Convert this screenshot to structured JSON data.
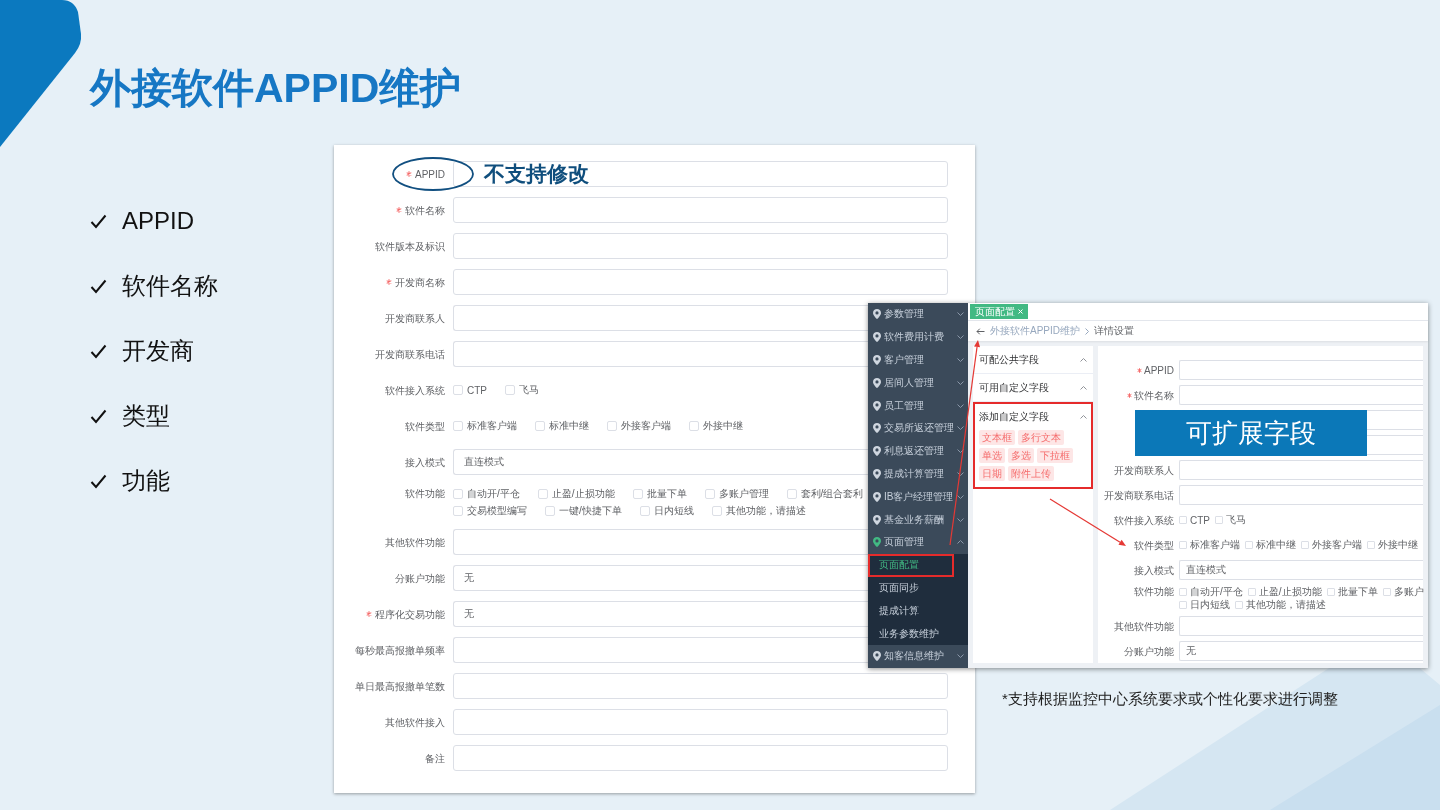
{
  "slide": {
    "title": "外接软件APPID维护"
  },
  "bullets": [
    "APPID",
    "软件名称",
    "开发商",
    "类型",
    "功能"
  ],
  "main_form": {
    "fields": [
      {
        "label": "APPID",
        "required": true,
        "kind": "input",
        "circled": true,
        "annotation": "不支持修改"
      },
      {
        "label": "软件名称",
        "required": true,
        "kind": "input",
        "circled": false
      },
      {
        "label": "软件版本及标识",
        "required": false,
        "kind": "input",
        "circled": false
      },
      {
        "label": "开发商名称",
        "required": true,
        "kind": "input",
        "circled": false
      },
      {
        "label": "开发商联系人",
        "required": false,
        "kind": "input",
        "circled": false
      },
      {
        "label": "开发商联系电话",
        "required": false,
        "kind": "input",
        "circled": false
      },
      {
        "label": "软件接入系统",
        "required": false,
        "kind": "checks",
        "circled": false,
        "lines": [
          [
            {
              "label": "CTP",
              "checked": false
            },
            {
              "label": "飞马",
              "checked": false
            }
          ]
        ]
      },
      {
        "label": "软件类型",
        "required": false,
        "kind": "checks",
        "circled": false,
        "lines": [
          [
            {
              "label": "标准客户端",
              "checked": false
            },
            {
              "label": "标准中继",
              "checked": false
            },
            {
              "label": "外接客户端",
              "checked": false
            },
            {
              "label": "外接中继",
              "checked": false
            }
          ]
        ]
      },
      {
        "label": "接入模式",
        "required": false,
        "kind": "input",
        "circled": false,
        "value": "直连模式"
      },
      {
        "label": "软件功能",
        "required": false,
        "kind": "checks",
        "circled": false,
        "lines": [
          [
            {
              "label": "自动开/平仓",
              "checked": false
            },
            {
              "label": "止盈/止损功能",
              "checked": false
            },
            {
              "label": "批量下单",
              "checked": false
            },
            {
              "label": "多账户管理",
              "checked": false
            },
            {
              "label": "套利/组合套利",
              "checked": false
            }
          ],
          [
            {
              "label": "交易模型编写",
              "checked": false
            },
            {
              "label": "一键/快捷下单",
              "checked": false
            },
            {
              "label": "日内短线",
              "checked": false
            },
            {
              "label": "其他功能，请描述",
              "checked": false
            }
          ]
        ]
      },
      {
        "label": "其他软件功能",
        "required": false,
        "kind": "input",
        "circled": false
      },
      {
        "label": "分账户功能",
        "required": false,
        "kind": "input",
        "circled": false,
        "value": "无"
      },
      {
        "label": "程序化交易功能",
        "required": true,
        "kind": "input",
        "circled": false,
        "value": "无"
      },
      {
        "label": "每秒最高报撤单频率",
        "required": false,
        "kind": "input",
        "circled": false
      },
      {
        "label": "单日最高报撤单笔数",
        "required": false,
        "kind": "input",
        "circled": false
      },
      {
        "label": "其他软件接入",
        "required": false,
        "kind": "input",
        "circled": false
      },
      {
        "label": "备注",
        "required": false,
        "kind": "input",
        "circled": false
      }
    ]
  },
  "inset": {
    "sidebar": [
      {
        "label": "参数管理",
        "expanded": false
      },
      {
        "label": "软件费用计费",
        "expanded": false
      },
      {
        "label": "客户管理",
        "expanded": false
      },
      {
        "label": "居间人管理",
        "expanded": false
      },
      {
        "label": "员工管理",
        "expanded": false
      },
      {
        "label": "交易所返还管理",
        "expanded": false
      },
      {
        "label": "利息返还管理",
        "expanded": false
      },
      {
        "label": "提成计算管理",
        "expanded": false
      },
      {
        "label": "IB客户经理管理",
        "expanded": false
      },
      {
        "label": "基金业务薪酬",
        "expanded": false
      },
      {
        "label": "页面管理",
        "expanded": true,
        "children": [
          {
            "label": "页面配置",
            "selected": true,
            "highlighted": true
          },
          {
            "label": "页面同步",
            "selected": false,
            "highlighted": false
          },
          {
            "label": "提成计算",
            "selected": false,
            "highlighted": false
          },
          {
            "label": "业务参数维护",
            "selected": false,
            "highlighted": false
          }
        ]
      },
      {
        "label": "知客信息维护",
        "expanded": false
      }
    ],
    "tabs": [
      {
        "label": "页面配置",
        "selected": true
      }
    ],
    "breadcrumb": [
      "外接软件APPID维护",
      "详情设置"
    ],
    "panels": [
      {
        "title": "可配公共字段",
        "expanded": true,
        "highlighted": false
      },
      {
        "title": "可用自定义字段",
        "expanded": true,
        "highlighted": false
      },
      {
        "title": "添加自定义字段",
        "expanded": true,
        "highlighted": true,
        "tags": [
          "文本框",
          "多行文本",
          "单选",
          "多选",
          "下拉框",
          "日期",
          "附件上传"
        ]
      }
    ],
    "form": {
      "rows": [
        {
          "label": "APPID",
          "required": true,
          "kind": "input"
        },
        {
          "label": "软件名称",
          "required": true,
          "kind": "input"
        },
        {
          "kind": "input"
        },
        {
          "kind": "input"
        },
        {
          "label": "开发商联系人",
          "required": false,
          "kind": "input"
        },
        {
          "label": "开发商联系电话",
          "required": false,
          "kind": "input"
        },
        {
          "label": "软件接入系统",
          "required": false,
          "kind": "checks",
          "lines": [
            [
              {
                "label": "CTP",
                "checked": false
              },
              {
                "label": "飞马",
                "checked": false
              }
            ]
          ]
        },
        {
          "label": "软件类型",
          "required": false,
          "kind": "checks",
          "lines": [
            [
              {
                "label": "标准客户端",
                "checked": false
              },
              {
                "label": "标准中继",
                "checked": false
              },
              {
                "label": "外接客户端",
                "checked": false
              },
              {
                "label": "外接中继",
                "checked": false
              }
            ]
          ]
        },
        {
          "label": "接入模式",
          "required": false,
          "kind": "input",
          "value": "直连模式"
        },
        {
          "label": "软件功能",
          "required": false,
          "kind": "checks",
          "lines": [
            [
              {
                "label": "自动开/平仓",
                "checked": false
              },
              {
                "label": "止盈/止损功能",
                "checked": false
              },
              {
                "label": "批量下单",
                "checked": false
              },
              {
                "label": "多账户",
                "checked": false
              }
            ],
            [
              {
                "label": "日内短线",
                "checked": false
              },
              {
                "label": "其他功能，请描述",
                "checked": false
              }
            ]
          ]
        },
        {
          "label": "其他软件功能",
          "required": false,
          "kind": "input"
        },
        {
          "label": "分账户功能",
          "required": false,
          "kind": "input",
          "value": "无"
        }
      ]
    },
    "callout": "可扩展字段"
  },
  "caption": "*支持根据监控中心系统要求或个性化要求进行调整"
}
